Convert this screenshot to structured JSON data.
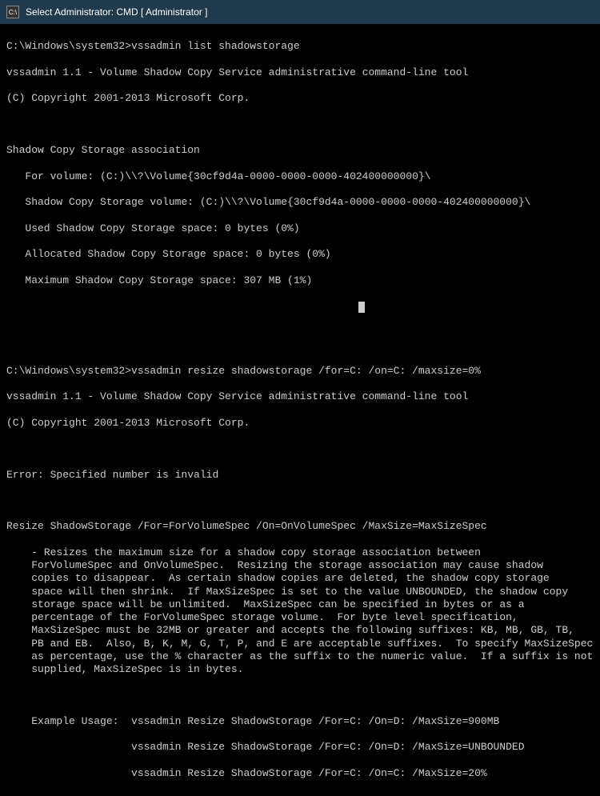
{
  "window": {
    "icon_text": "C:\\",
    "title": "Select Administrator: CMD [ Administrator ]"
  },
  "terminal": {
    "prompt1": "C:\\Windows\\system32>vssadmin list shadowstorage",
    "banner1a": "vssadmin 1.1 - Volume Shadow Copy Service administrative command-line tool",
    "banner1b": "(C) Copyright 2001-2013 Microsoft Corp.",
    "assoc_title": "Shadow Copy Storage association",
    "assoc_for": "   For volume: (C:)\\\\?\\Volume{30cf9d4a-0000-0000-0000-402400000000}\\",
    "assoc_vol": "   Shadow Copy Storage volume: (C:)\\\\?\\Volume{30cf9d4a-0000-0000-0000-402400000000}\\",
    "assoc_used": "   Used Shadow Copy Storage space: 0 bytes (0%)",
    "assoc_alloc": "   Allocated Shadow Copy Storage space: 0 bytes (0%)",
    "assoc_max": "   Maximum Shadow Copy Storage space: 307 MB (1%)",
    "prompt2": "C:\\Windows\\system32>vssadmin resize shadowstorage /for=C: /on=C: /maxsize=0%",
    "banner2a": "vssadmin 1.1 - Volume Shadow Copy Service administrative command-line tool",
    "banner2b": "(C) Copyright 2001-2013 Microsoft Corp.",
    "error": "Error: Specified number is invalid",
    "help_title": "Resize ShadowStorage /For=ForVolumeSpec /On=OnVolumeSpec /MaxSize=MaxSizeSpec",
    "help_body": "    - Resizes the maximum size for a shadow copy storage association between\n    ForVolumeSpec and OnVolumeSpec.  Resizing the storage association may cause shadow\n    copies to disappear.  As certain shadow copies are deleted, the shadow copy storage\n    space will then shrink.  If MaxSizeSpec is set to the value UNBOUNDED, the shadow copy\n    storage space will be unlimited.  MaxSizeSpec can be specified in bytes or as a\n    percentage of the ForVolumeSpec storage volume.  For byte level specification,\n    MaxSizeSpec must be 32MB or greater and accepts the following suffixes: KB, MB, GB, TB,\n    PB and EB.  Also, B, K, M, G, T, P, and E are acceptable suffixes.  To specify MaxSizeSpec\n    as percentage, use the % character as the suffix to the numeric value.  If a suffix is not\n    supplied, MaxSizeSpec is in bytes.",
    "example_title": "    Example Usage:  vssadmin Resize ShadowStorage /For=C: /On=D: /MaxSize=900MB",
    "example_2": "                    vssadmin Resize ShadowStorage /For=C: /On=D: /MaxSize=UNBOUNDED",
    "example_3": "                    vssadmin Resize ShadowStorage /For=C: /On=C: /MaxSize=20%"
  }
}
